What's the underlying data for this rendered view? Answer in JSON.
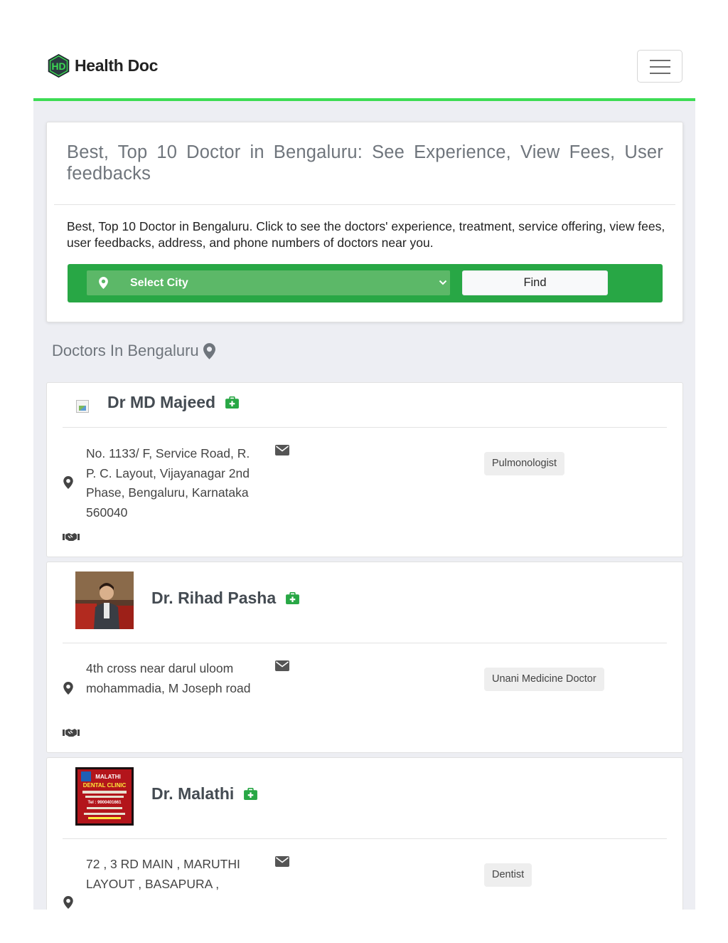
{
  "brand": {
    "logo_text": "HD",
    "name": "Health Doc"
  },
  "hero": {
    "title": "Best, Top 10 Doctor in Bengaluru: See Experience, View Fees, User feedbacks",
    "description": "Best, Top 10 Doctor in Bengaluru. Click to see the doctors' experience, treatment, service offering, view fees, user feedbacks, address, and phone numbers of doctors near you.",
    "city_select": {
      "selected": "Select City"
    },
    "find_label": "Find"
  },
  "section": {
    "title": "Doctors In Bengaluru"
  },
  "doctors": [
    {
      "name": "Dr MD Majeed",
      "address": "No. 1133/ F, Service Road, R. P. C. Layout, Vijayanagar 2nd Phase, Bengaluru, Karnataka 560040",
      "specialty": "Pulmonologist"
    },
    {
      "name": "Dr. Rihad Pasha",
      "address": "4th cross near darul uloom mohammadia, M Joseph road",
      "specialty": "Unani Medicine Doctor"
    },
    {
      "name": "Dr. Malathi",
      "address": "72 , 3 RD MAIN , MARUTHI LAYOUT , BASAPURA ,",
      "specialty": "Dentist",
      "photo_text": {
        "line1": "MALATHI",
        "line2": "DENTAL CLINIC",
        "line3": "Tel : 9900401661"
      }
    }
  ],
  "colors": {
    "accent_green": "#28a745",
    "nav_border": "#3ddc54",
    "title_gray": "#6f757c"
  }
}
